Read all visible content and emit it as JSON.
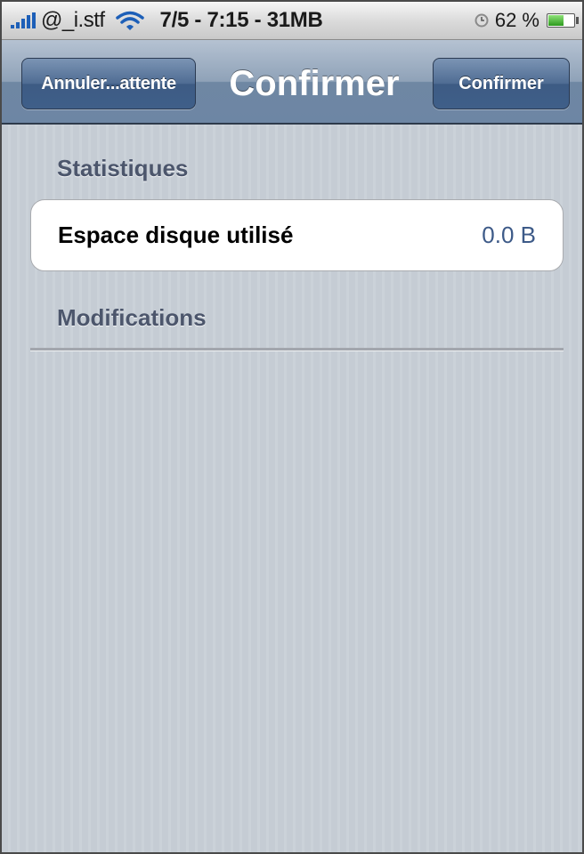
{
  "status_bar": {
    "carrier": "@_i.stf",
    "center_text": "7/5 - 7:15 - 31MB",
    "battery_percent": "62 %",
    "battery_level": 0.62,
    "icons": [
      "signal-bars-icon",
      "wifi-icon",
      "alarm-clock-icon",
      "battery-icon"
    ]
  },
  "nav": {
    "title": "Confirmer",
    "left_button": "Annuler...attente",
    "right_button": "Confirmer"
  },
  "sections": {
    "statistics_header": "Statistiques",
    "modifications_header": "Modifications"
  },
  "disk_usage": {
    "label": "Espace disque utilisé",
    "value": "0.0 B"
  },
  "colors": {
    "background_stripes": "#c5ccd4",
    "nav_bar": "#6d86a4",
    "section_header_text": "#4c566c",
    "value_text": "#3d5a88"
  }
}
